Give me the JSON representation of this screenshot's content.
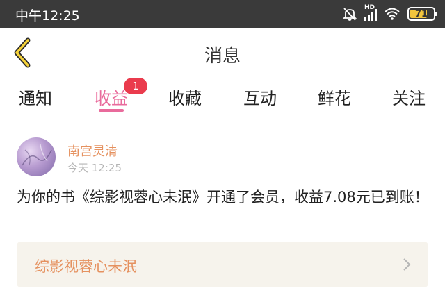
{
  "status_bar": {
    "time": "中午12:25",
    "signal_label": "HD",
    "battery_level": "71"
  },
  "nav": {
    "title": "消息"
  },
  "tabs": [
    {
      "label": "通知"
    },
    {
      "label": "收益",
      "badge": "1",
      "active": true
    },
    {
      "label": "收藏"
    },
    {
      "label": "互动"
    },
    {
      "label": "鲜花"
    },
    {
      "label": "关注"
    }
  ],
  "message": {
    "sender": "南宫灵清",
    "time": "今天 12:25",
    "body": "为你的书《综影视蓉心未泯》开通了会员，收益7.08元已到账！",
    "book_title": "综影视蓉心未泯"
  },
  "colors": {
    "accent": "#e96b9c",
    "badge": "#ea3b4d",
    "highlight": "#e5915f",
    "card_bg": "#f6f3ec",
    "status_bg": "#3a3a3a"
  }
}
